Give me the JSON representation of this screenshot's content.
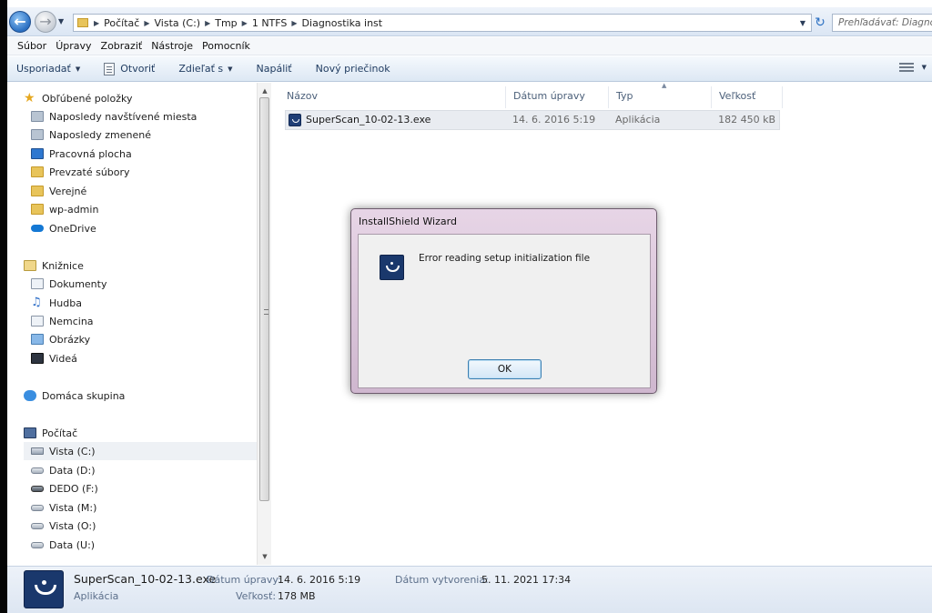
{
  "address_bar": {
    "crumbs": [
      "Počítač",
      "Vista (C:)",
      "Tmp",
      "1 NTFS",
      "Diagnostika inst"
    ],
    "search_placeholder": "Prehľadávať: Diagnos"
  },
  "menubar": [
    "Súbor",
    "Úpravy",
    "Zobraziť",
    "Nástroje",
    "Pomocník"
  ],
  "commandbar": {
    "organize": "Usporiadať",
    "open": "Otvoriť",
    "share": "Zdieľať s",
    "burn": "Napáliť",
    "new_folder": "Nový priečinok"
  },
  "nav": {
    "favorites": "Obľúbené položky",
    "recent_places": "Naposledy navštívené miesta",
    "recent_changed": "Naposledy zmenené",
    "desktop": "Pracovná plocha",
    "downloads": "Prevzaté súbory",
    "public": "Verejné",
    "wp_admin": "wp-admin",
    "onedrive": "OneDrive",
    "libraries": "Knižnice",
    "documents": "Dokumenty",
    "music": "Hudba",
    "nemcina": "Nemcina",
    "pictures": "Obrázky",
    "videos": "Videá",
    "homegroup": "Domáca skupina",
    "computer": "Počítač",
    "drive_c": "Vista (C:)",
    "drive_d": "Data (D:)",
    "drive_f": "DEDO (F:)",
    "drive_m": "Vista (M:)",
    "drive_o": "Vista (O:)",
    "drive_u": "Data (U:)"
  },
  "filelist": {
    "headers": {
      "name": "Názov",
      "date": "Dátum úpravy",
      "type": "Typ",
      "size": "Veľkosť"
    },
    "rows": [
      {
        "name": "SuperScan_10-02-13.exe",
        "date": "14. 6. 2016 5:19",
        "type": "Aplikácia",
        "size": "182 450 kB"
      }
    ]
  },
  "details": {
    "filename": "SuperScan_10-02-13.exe",
    "kind": "Aplikácia",
    "modified_label": "Dátum úpravy:",
    "modified_value": "14. 6. 2016 5:19",
    "size_label": "Veľkosť:",
    "size_value": "178 MB",
    "created_label": "Dátum vytvorenia:",
    "created_value": "5. 11. 2021 17:34"
  },
  "dialog": {
    "title": "InstallShield Wizard",
    "message": "Error reading setup initialization file",
    "ok": "OK"
  }
}
